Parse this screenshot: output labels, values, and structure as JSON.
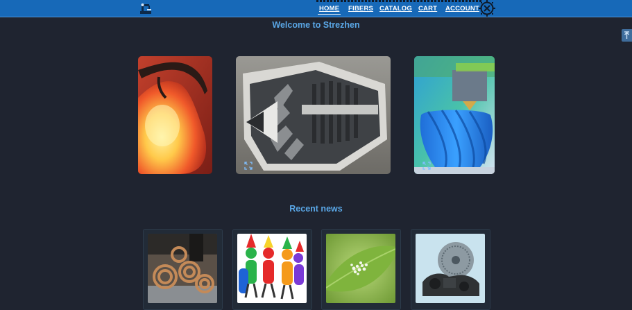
{
  "nav": {
    "logo_icon": "robot-arm-logo-icon",
    "links": [
      {
        "label": "HOME",
        "active": true
      },
      {
        "label": "FIBERS",
        "active": false
      },
      {
        "label": "CATALOG",
        "active": false
      },
      {
        "label": "CART",
        "active": false
      },
      {
        "label": "ACCOUNT",
        "active": false
      }
    ],
    "settings_icon": "gear-icon"
  },
  "main": {
    "welcome_title": "Welcome to Strezhen",
    "carousel": {
      "slides": [
        {
          "subject": "glowing 3D printed lamp"
        },
        {
          "subject": "3D printed jet turbine model"
        },
        {
          "subject": "3D printer printing blue spiral vase"
        }
      ],
      "expand_icon": "expand-arrows-icon"
    },
    "news_title": "Recent news",
    "news": [
      {
        "subject": "spiral 3D printed pieces"
      },
      {
        "subject": "colorful party figures"
      },
      {
        "subject": "leaf with granules"
      },
      {
        "subject": "printed mechanical parts"
      }
    ]
  },
  "scroll_top_icon": "arrow-up-icon",
  "colors": {
    "background": "#1f2430",
    "navbar": "#1769b8",
    "heading": "#5aa7e6"
  }
}
